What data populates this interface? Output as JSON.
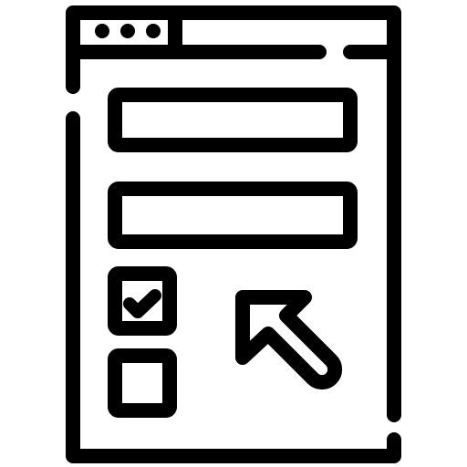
{
  "icon": {
    "name": "web-form-icon",
    "stroke_color": "#000000",
    "background_color": "#ffffff",
    "parts": {
      "window_frame": "browser-window-icon",
      "window_controls": "three-dots-icon",
      "address_bar": "address-bar-icon",
      "text_field_1": "text-field-icon",
      "text_field_2": "text-field-icon",
      "checkbox_checked": "checkbox-checked-icon",
      "checkbox_unchecked": "checkbox-unchecked-icon",
      "cursor": "pointer-cursor-icon"
    },
    "checkboxes": [
      {
        "checked": true
      },
      {
        "checked": false
      }
    ]
  }
}
